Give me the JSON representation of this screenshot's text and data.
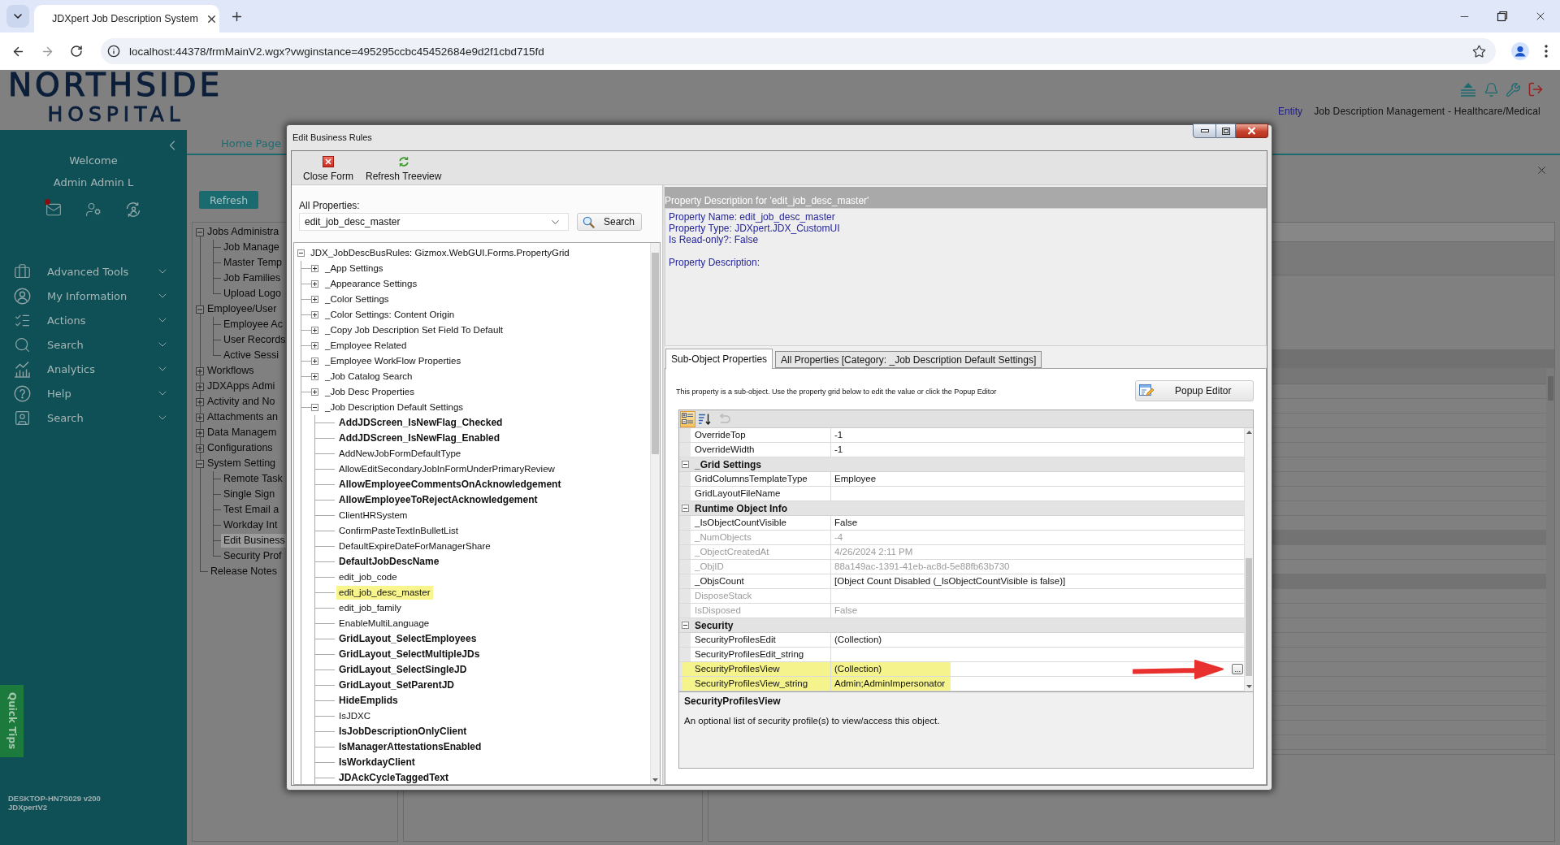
{
  "browser": {
    "tab_title": "JDXpert Job Description System",
    "url": "localhost:44378/frmMainV2.wgx?vwginstance=495295ccbc45452684e9d2f1cbd715fd"
  },
  "header": {
    "logo": [
      "NORTHSIDE",
      "HOSPITAL"
    ],
    "entity_link": "Entity",
    "app_title": "Job Description Management - Healthcare/Medical"
  },
  "sidebar": {
    "welcome": "Welcome",
    "user_name": "Admin Admin L",
    "mail_unread": true,
    "menu": [
      {
        "label": "Advanced Tools",
        "expanded": false
      },
      {
        "label": "My Information",
        "expanded": false
      },
      {
        "label": "Actions",
        "expanded": false
      },
      {
        "label": "Search",
        "expanded": false
      },
      {
        "label": "Analytics",
        "expanded": false
      },
      {
        "label": "Help",
        "expanded": false
      },
      {
        "label": "Search",
        "expanded": false
      }
    ],
    "quick_tips": "Quick Tips",
    "footer": [
      "DESKTOP-HN7S029 v200",
      "JDXpertV2"
    ]
  },
  "main": {
    "tabs": [
      {
        "label": "Home Page",
        "selected": true
      }
    ],
    "refresh_button": "Refresh",
    "nav_tree": [
      {
        "label": "Jobs Administra",
        "expanded": true,
        "selected": false,
        "children": [
          {
            "label": "Job Manage",
            "selected": false
          },
          {
            "label": "Master Temp",
            "selected": false
          },
          {
            "label": "Job Families",
            "selected": false
          },
          {
            "label": "Upload Logo",
            "selected": false
          }
        ]
      },
      {
        "label": "Employee/User",
        "expanded": true,
        "selected": false,
        "children": [
          {
            "label": "Employee Ac",
            "selected": false
          },
          {
            "label": "User Records",
            "selected": false
          },
          {
            "label": "Active Sessi",
            "selected": false
          }
        ]
      },
      {
        "label": "Workflows",
        "expanded": false,
        "selected": false
      },
      {
        "label": "JDXApps Admi",
        "expanded": false,
        "selected": false
      },
      {
        "label": "Activity and No",
        "expanded": false,
        "selected": false
      },
      {
        "label": "Attachments an",
        "expanded": false,
        "selected": false
      },
      {
        "label": "Data Managem",
        "expanded": false,
        "selected": false
      },
      {
        "label": "Configurations",
        "expanded": false,
        "selected": false
      },
      {
        "label": "System Setting",
        "expanded": true,
        "selected": false,
        "children": [
          {
            "label": "Remote Task",
            "selected": false
          },
          {
            "label": "Single Sign",
            "selected": false
          },
          {
            "label": "Test Email a",
            "selected": false
          },
          {
            "label": "Workday Int",
            "selected": false
          },
          {
            "label": "Edit Business",
            "selected": true
          },
          {
            "label": "Security Prof",
            "selected": false
          }
        ]
      },
      {
        "label": "Release Notes",
        "selected": false
      }
    ]
  },
  "dialog": {
    "title": "Edit Business Rules",
    "toolbar": [
      {
        "kind": "close",
        "label": "Close Form"
      },
      {
        "kind": "refresh",
        "label": "Refresh Treeview"
      }
    ],
    "properties_label": "All Properties:",
    "properties_combo": "edit_job_desc_master",
    "search_button": "Search",
    "property_tree": {
      "label": "JDX_JobDescBusRules: Gizmox.WebGUI.Forms.PropertyGrid",
      "expanded": true,
      "selected": false,
      "children": [
        {
          "label": "_App Settings",
          "expanded": false,
          "selected": false
        },
        {
          "label": "_Appearance Settings",
          "expanded": false,
          "selected": false
        },
        {
          "label": "_Color Settings",
          "expanded": false,
          "selected": false
        },
        {
          "label": "_Color Settings: Content Origin",
          "expanded": false,
          "selected": false
        },
        {
          "label": "_Copy Job Description Set Field To Default",
          "expanded": false,
          "selected": false
        },
        {
          "label": "_Employee Related",
          "expanded": false,
          "selected": false
        },
        {
          "label": "_Employee WorkFlow Properties",
          "expanded": false,
          "selected": false
        },
        {
          "label": "_Job Catalog Search",
          "expanded": false,
          "selected": false
        },
        {
          "label": "_Job Desc Properties",
          "expanded": false,
          "selected": false
        },
        {
          "label": "_Job Description Default Settings",
          "expanded": true,
          "selected": false,
          "children": [
            {
              "label": "AddJDScreen_IsNewFlag_Checked",
              "modified": true,
              "selected": false
            },
            {
              "label": "AddJDScreen_IsNewFlag_Enabled",
              "modified": true,
              "selected": false
            },
            {
              "label": "AddNewJobFormDefaultType",
              "modified": false,
              "selected": false
            },
            {
              "label": "AllowEditSecondaryJobInFormUnderPrimaryReview",
              "modified": false,
              "selected": false
            },
            {
              "label": "AllowEmployeeCommentsOnAcknowledgement",
              "modified": true,
              "selected": false
            },
            {
              "label": "AllowEmployeeToRejectAcknowledgement",
              "modified": true,
              "selected": false
            },
            {
              "label": "ClientHRSystem",
              "modified": false,
              "selected": false
            },
            {
              "label": "ConfirmPasteTextInBulletList",
              "modified": false,
              "selected": false
            },
            {
              "label": "DefaultExpireDateForManagerShare",
              "modified": false,
              "selected": false
            },
            {
              "label": "DefaultJobDescName",
              "modified": true,
              "selected": false
            },
            {
              "label": "edit_job_code",
              "modified": false,
              "selected": false
            },
            {
              "label": "edit_job_desc_master",
              "modified": false,
              "selected": true
            },
            {
              "label": "edit_job_family",
              "modified": false,
              "selected": false
            },
            {
              "label": "EnableMultiLanguage",
              "modified": false,
              "selected": false
            },
            {
              "label": "GridLayout_SelectEmployees",
              "modified": true,
              "selected": false
            },
            {
              "label": "GridLayout_SelectMultipleJDs",
              "modified": true,
              "selected": false
            },
            {
              "label": "GridLayout_SelectSingleJD",
              "modified": true,
              "selected": false
            },
            {
              "label": "GridLayout_SetParentJD",
              "modified": true,
              "selected": false
            },
            {
              "label": "HideEmplids",
              "modified": true,
              "selected": false
            },
            {
              "label": "IsJDXC",
              "modified": false,
              "selected": false
            },
            {
              "label": "IsJobDescriptionOnlyClient",
              "modified": true,
              "selected": false
            },
            {
              "label": "IsManagerAttestationsEnabled",
              "modified": true,
              "selected": false
            },
            {
              "label": "IsWorkdayClient",
              "modified": true,
              "selected": false
            },
            {
              "label": "JDAckCycleTaggedText",
              "modified": true,
              "selected": false
            }
          ]
        }
      ]
    },
    "description": {
      "header": "Property Description for 'edit_job_desc_master'",
      "lines": [
        "Property Name: edit_job_desc_master",
        "Property Type: JDXpert.JDX_CustomUI",
        "Is Read-only?: False"
      ],
      "description_label": "Property Description:"
    },
    "tabs": [
      {
        "label": "Sub-Object Properties",
        "selected": true
      },
      {
        "label": "All Properties [Category: _Job Description Default Settings]",
        "selected": false
      }
    ],
    "note": "This property is a sub-object. Use the property grid below to edit the value or click the Popup Editor",
    "popup_editor_button": "Popup Editor",
    "grid": {
      "view_modes": [
        {
          "kind": "categorized",
          "selected": true
        },
        {
          "kind": "alphabetical",
          "selected": false
        }
      ],
      "undo": {
        "disabled": true
      },
      "rows": [
        {
          "kind": "property",
          "name": "OverrideTop",
          "value": "-1",
          "read_only": false,
          "highlighted": false
        },
        {
          "kind": "property",
          "name": "OverrideWidth",
          "value": "-1",
          "read_only": false,
          "highlighted": false
        },
        {
          "kind": "category",
          "name": "_Grid Settings",
          "expanded": true
        },
        {
          "kind": "property",
          "name": "GridColumnsTemplateType",
          "value": "Employee",
          "read_only": false,
          "highlighted": false
        },
        {
          "kind": "property",
          "name": "GridLayoutFileName",
          "read_only": false,
          "highlighted": false
        },
        {
          "kind": "category",
          "name": "Runtime Object Info",
          "expanded": true
        },
        {
          "kind": "property",
          "name": "_IsObjectCountVisible",
          "value": "False",
          "read_only": false,
          "highlighted": false
        },
        {
          "kind": "property",
          "name": "_NumObjects",
          "value": "-4",
          "read_only": true,
          "highlighted": false
        },
        {
          "kind": "property",
          "name": "_ObjectCreatedAt",
          "value": "4/26/2024 2:11 PM",
          "read_only": true,
          "highlighted": false
        },
        {
          "kind": "property",
          "name": "_ObjID",
          "value": "88a149ac-1391-41eb-ac8d-5e88fb63b730",
          "read_only": true,
          "highlighted": false
        },
        {
          "kind": "property",
          "name": "_ObjsCount",
          "value": "[Object Count Disabled (_IsObjectCountVisible is false)]",
          "read_only": false,
          "highlighted": false
        },
        {
          "kind": "property",
          "name": "DisposeStack",
          "read_only": true,
          "highlighted": false
        },
        {
          "kind": "property",
          "name": "IsDisposed",
          "value": "False",
          "read_only": true,
          "highlighted": false
        },
        {
          "kind": "category",
          "name": "Security",
          "expanded": true
        },
        {
          "kind": "property",
          "name": "SecurityProfilesEdit",
          "value": "(Collection)",
          "read_only": false,
          "highlighted": false
        },
        {
          "kind": "property",
          "name": "SecurityProfilesEdit_string",
          "read_only": false,
          "highlighted": false
        },
        {
          "kind": "property",
          "name": "SecurityProfilesView",
          "value": "(Collection)",
          "editor_button": "...",
          "read_only": false,
          "highlighted": true
        },
        {
          "kind": "property",
          "name": "SecurityProfilesView_string",
          "value": "Admin;AdminImpersonator",
          "read_only": false,
          "highlighted": true
        }
      ]
    },
    "help": {
      "title": "SecurityProfilesView",
      "text": "An optional list of security profile(s) to view/access this object."
    }
  }
}
